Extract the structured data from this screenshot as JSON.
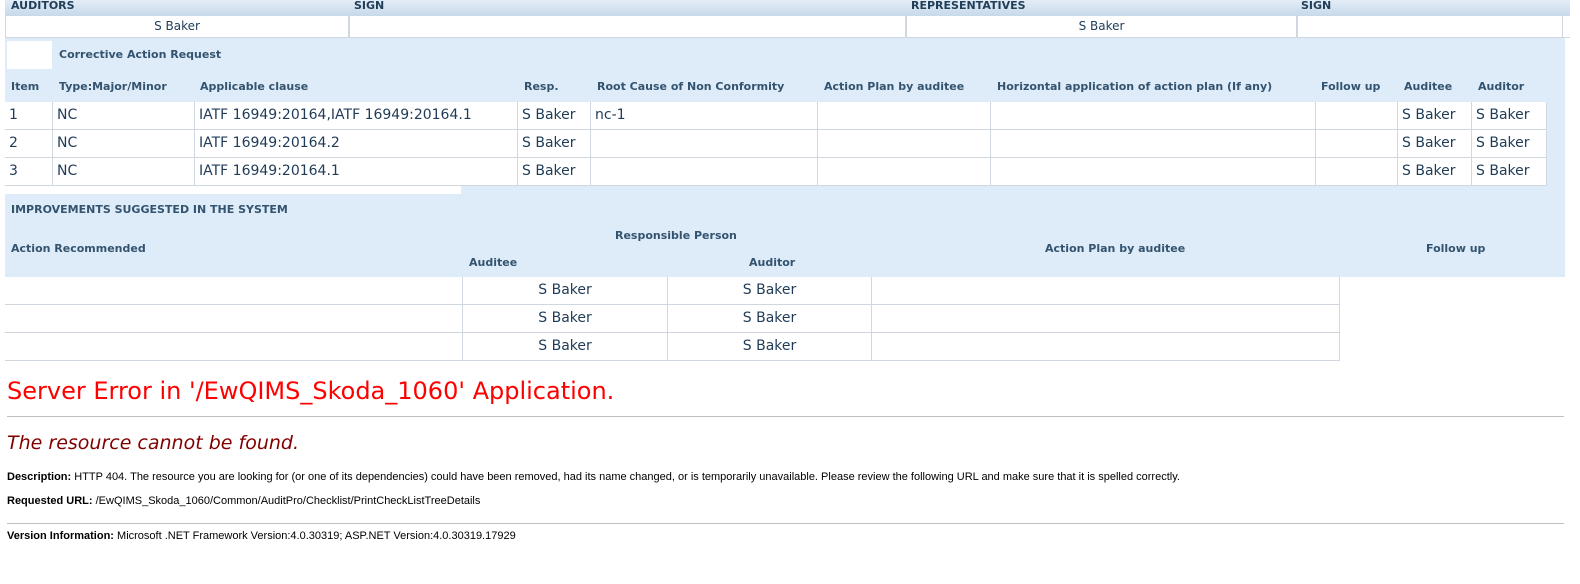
{
  "signatures": {
    "headers": {
      "auditors": "AUDITORS",
      "sign1": "SIGN",
      "representatives": "REPRESENTATIVES",
      "sign2": "SIGN"
    },
    "values": {
      "auditor": "S Baker",
      "sign1": "",
      "representative": "S Baker",
      "sign2": ""
    }
  },
  "car": {
    "title": "Corrective Action Request",
    "columns": [
      "Item",
      "Type:Major/Minor",
      "Applicable clause",
      "Resp.",
      "Root Cause of Non Conformity",
      "Action Plan by auditee",
      "Horizontal application of action plan (If any)",
      "Follow up",
      "Auditee",
      "Auditor"
    ],
    "rows": [
      {
        "item": "1",
        "type": "NC",
        "clause": "IATF 16949:20164,IATF 16949:20164.1",
        "resp": "S Baker",
        "root": "nc-1",
        "plan": "",
        "horizontal": "",
        "follow": "",
        "auditee": "S Baker",
        "auditor": "S Baker"
      },
      {
        "item": "2",
        "type": "NC",
        "clause": "IATF 16949:20164.2",
        "resp": "S Baker",
        "root": "",
        "plan": "",
        "horizontal": "",
        "follow": "",
        "auditee": "S Baker",
        "auditor": "S Baker"
      },
      {
        "item": "3",
        "type": "NC",
        "clause": "IATF 16949:20164.1",
        "resp": "S Baker",
        "root": "",
        "plan": "",
        "horizontal": "",
        "follow": "",
        "auditee": "S Baker",
        "auditor": "S Baker"
      }
    ]
  },
  "improvements": {
    "title": "IMPROVEMENTS SUGGESTED IN THE SYSTEM",
    "headers": {
      "action": "Action Recommended",
      "responsible": "Responsible Person",
      "auditee": "Auditee",
      "auditor": "Auditor",
      "plan": "Action Plan by auditee",
      "follow": "Follow up"
    },
    "rows": [
      {
        "action": "",
        "auditee": "S Baker",
        "auditor": "S Baker",
        "plan": ""
      },
      {
        "action": "",
        "auditee": "S Baker",
        "auditor": "S Baker",
        "plan": ""
      },
      {
        "action": "",
        "auditee": "S Baker",
        "auditor": "S Baker",
        "plan": ""
      }
    ]
  },
  "error": {
    "title": "Server Error in '/EwQIMS_Skoda_1060' Application.",
    "subtitle": "The resource cannot be found.",
    "description_label": "Description:",
    "description": "HTTP 404. The resource you are looking for (or one of its dependencies) could have been removed, had its name changed, or is temporarily unavailable.  Please review the following URL and make sure that it is spelled correctly.",
    "url_label": "Requested URL:",
    "url": "/EwQIMS_Skoda_1060/Common/AuditPro/Checklist/PrintCheckListTreeDetails",
    "version_label": "Version Information:",
    "version": "Microsoft .NET Framework Version:4.0.30319; ASP.NET Version:4.0.30319.17929"
  },
  "colors": {
    "header_bg": "#ddecf8",
    "header_text": "#34536f",
    "error_red": "#ff0000",
    "error_maroon": "#800000"
  }
}
